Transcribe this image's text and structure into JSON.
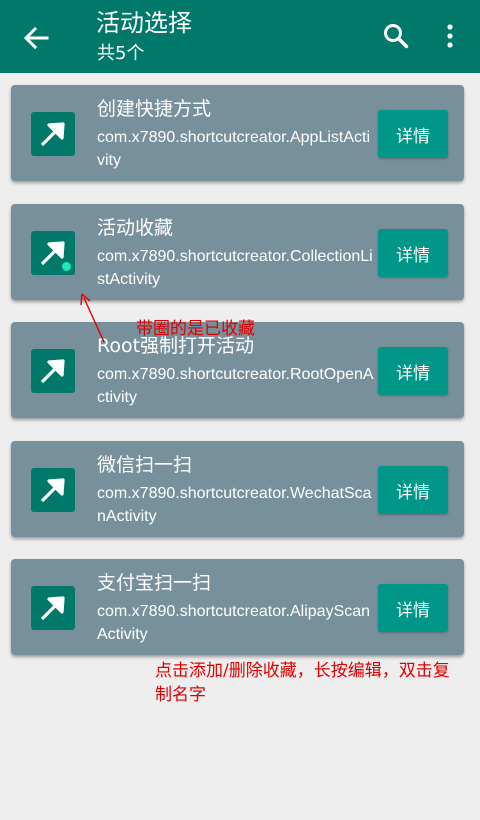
{
  "appbar": {
    "title": "活动选择",
    "subtitle": "共5个",
    "back_icon": "arrow-back-icon",
    "search_icon": "search-icon",
    "more_icon": "more-vert-icon"
  },
  "colors": {
    "appbar": "#00796b",
    "card": "#78909c",
    "button": "#009688",
    "annotation": "#e00000"
  },
  "activities": [
    {
      "name": "创建快捷方式",
      "package": "com.x7890.shortcutcreator.AppListActivity",
      "button": "详情",
      "favorited": false
    },
    {
      "name": "活动收藏",
      "package": "com.x7890.shortcutcreator.CollectionListActivity",
      "button": "详情",
      "favorited": true
    },
    {
      "name": "Root强制打开活动",
      "package": "com.x7890.shortcutcreator.RootOpenActivity",
      "button": "详情",
      "favorited": false
    },
    {
      "name": "微信扫一扫",
      "package": "com.x7890.shortcutcreator.WechatScanActivity",
      "button": "详情",
      "favorited": false
    },
    {
      "name": "支付宝扫一扫",
      "package": "com.x7890.shortcutcreator.AlipayScanActivity",
      "button": "详情",
      "favorited": false
    }
  ],
  "annotations": {
    "favorite_note": "带圈的是已收藏",
    "usage_note": "点击添加/删除收藏，长按编辑，双击复制名字"
  }
}
